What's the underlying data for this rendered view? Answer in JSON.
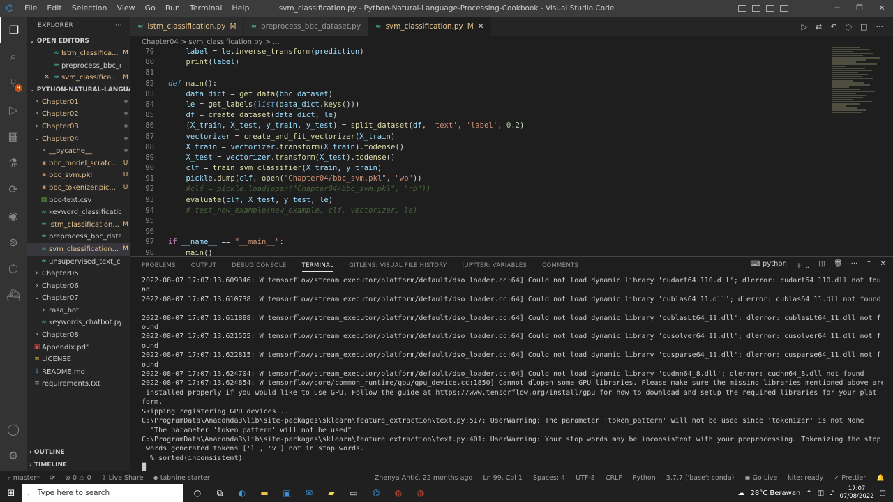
{
  "titlebar": {
    "menu": [
      "File",
      "Edit",
      "Selection",
      "View",
      "Go",
      "Run",
      "Terminal",
      "Help"
    ],
    "window_title": "svm_classification.py - Python-Natural-Language-Processing-Cookbook - Visual Studio Code"
  },
  "explorer": {
    "header": "EXPLORER",
    "open_editors_label": "OPEN EDITORS",
    "open_editors": [
      {
        "name": "lstm_classifica...",
        "status": "M",
        "close": false
      },
      {
        "name": "preprocess_bbc_da...",
        "status": "",
        "close": false
      },
      {
        "name": "svm_classifica...",
        "status": "M",
        "close": true
      }
    ],
    "project_label": "PYTHON-NATURAL-LANGUA...",
    "tree": [
      {
        "name": "Chapter01",
        "type": "folder",
        "indent": 0,
        "status": "dot",
        "color": "#e2c08d"
      },
      {
        "name": "Chapter02",
        "type": "folder",
        "indent": 0,
        "status": "dot",
        "color": "#e2c08d"
      },
      {
        "name": "Chapter03",
        "type": "folder",
        "indent": 0,
        "status": "dot",
        "color": "#e2c08d"
      },
      {
        "name": "Chapter04",
        "type": "folder-open",
        "indent": 0,
        "status": "dot",
        "color": "#e2c08d"
      },
      {
        "name": "__pycache__",
        "type": "folder",
        "indent": 1,
        "status": "dot",
        "color": "#e2c08d"
      },
      {
        "name": "bbc_model_scratc...",
        "type": "file",
        "indent": 1,
        "status": "U",
        "color": "#e2c08d"
      },
      {
        "name": "bbc_svm.pkl",
        "type": "file",
        "indent": 1,
        "status": "U",
        "color": "#e2c08d"
      },
      {
        "name": "bbc_tokenizer.pic...",
        "type": "file",
        "indent": 1,
        "status": "U",
        "color": "#e2c08d"
      },
      {
        "name": "bbc-text.csv",
        "type": "csv",
        "indent": 1,
        "status": "",
        "color": "#cccccc"
      },
      {
        "name": "keyword_classification...",
        "type": "py",
        "indent": 1,
        "status": "",
        "color": "#cccccc"
      },
      {
        "name": "lstm_classification...",
        "type": "py",
        "indent": 1,
        "status": "M",
        "color": "#e2c08d"
      },
      {
        "name": "preprocess_bbc_datase...",
        "type": "py",
        "indent": 1,
        "status": "",
        "color": "#cccccc"
      },
      {
        "name": "svm_classification...",
        "type": "py",
        "indent": 1,
        "status": "M",
        "color": "#e2c08d",
        "selected": true
      },
      {
        "name": "unsupervised_text_clas...",
        "type": "py",
        "indent": 1,
        "status": "",
        "color": "#cccccc"
      },
      {
        "name": "Chapter05",
        "type": "folder",
        "indent": 0,
        "status": "",
        "color": "#cccccc"
      },
      {
        "name": "Chapter06",
        "type": "folder",
        "indent": 0,
        "status": "",
        "color": "#cccccc"
      },
      {
        "name": "Chapter07",
        "type": "folder-open",
        "indent": 0,
        "status": "",
        "color": "#cccccc"
      },
      {
        "name": "rasa_bot",
        "type": "folder",
        "indent": 1,
        "status": "",
        "color": "#cccccc"
      },
      {
        "name": "keywords_chatbot.py",
        "type": "py",
        "indent": 1,
        "status": "",
        "color": "#cccccc"
      },
      {
        "name": "Chapter08",
        "type": "folder",
        "indent": 0,
        "status": "",
        "color": "#cccccc"
      },
      {
        "name": "Appendix.pdf",
        "type": "pdf",
        "indent": 0,
        "status": "",
        "color": "#cccccc"
      },
      {
        "name": "LICENSE",
        "type": "license",
        "indent": 0,
        "status": "",
        "color": "#cccccc"
      },
      {
        "name": "README.md",
        "type": "md",
        "indent": 0,
        "status": "",
        "color": "#cccccc"
      },
      {
        "name": "requirements.txt",
        "type": "txt",
        "indent": 0,
        "status": "",
        "color": "#cccccc"
      }
    ],
    "outline_label": "OUTLINE",
    "timeline_label": "TIMELINE"
  },
  "tabs": [
    {
      "name": "lstm_classification.py",
      "status": "M",
      "active": false
    },
    {
      "name": "preprocess_bbc_dataset.py",
      "status": "",
      "active": false
    },
    {
      "name": "svm_classification.py",
      "status": "M",
      "active": true
    }
  ],
  "breadcrumb": "Chapter04 > svm_classification.py > ...",
  "code_lines": [
    {
      "n": "79",
      "html": "    <span class='v'>label</span> = <span class='v'>le</span>.<span class='f'>inverse_transform</span>(<span class='v'>prediction</span>)"
    },
    {
      "n": "80",
      "html": "    <span class='f'>print</span>(<span class='v'>label</span>)"
    },
    {
      "n": "81",
      "html": ""
    },
    {
      "n": "82",
      "html": "<span class='k'>def</span> <span class='f'>main</span>():"
    },
    {
      "n": "83",
      "html": "    <span class='v'>data_dict</span> = <span class='f'>get_data</span>(<span class='v'>bbc_dataset</span>)"
    },
    {
      "n": "84",
      "html": "    <span class='v'>le</span> = <span class='f'>get_labels</span>(<span class='k'>list</span>(<span class='v'>data_dict</span>.<span class='f'>keys</span>()))"
    },
    {
      "n": "85",
      "html": "    <span class='v'>df</span> = <span class='f'>create_dataset</span>(<span class='v'>data_dict</span>, <span class='v'>le</span>)"
    },
    {
      "n": "86",
      "html": "    (<span class='v'>X_train</span>, <span class='v'>X_test</span>, <span class='v'>y_train</span>, <span class='v'>y_test</span>) = <span class='f'>split_dataset</span>(<span class='v'>df</span>, <span class='s'>'text'</span>, <span class='s'>'label'</span>, <span class='n'>0.2</span>)"
    },
    {
      "n": "87",
      "html": "    <span class='v'>vectorizer</span> = <span class='f'>create_and_fit_vectorizer</span>(<span class='v'>X_train</span>)"
    },
    {
      "n": "88",
      "html": "    <span class='v'>X_train</span> = <span class='v'>vectorizer</span>.<span class='f'>transform</span>(<span class='v'>X_train</span>).<span class='f'>todense</span>()"
    },
    {
      "n": "89",
      "html": "    <span class='v'>X_test</span> = <span class='v'>vectorizer</span>.<span class='f'>transform</span>(<span class='v'>X_test</span>).<span class='f'>todense</span>()"
    },
    {
      "n": "90",
      "html": "    <span class='v'>clf</span> = <span class='f'>train_svm_classifier</span>(<span class='v'>X_train</span>, <span class='v'>y_train</span>)"
    },
    {
      "n": "91",
      "html": "    <span class='v'>pickle</span>.<span class='f'>dump</span>(<span class='v'>clf</span>, <span class='f'>open</span>(<span class='s'>\"Chapter04/bbc_svm.pkl\"</span>, <span class='s'>\"wb\"</span>))"
    },
    {
      "n": "92",
      "html": "    <span class='c'>#clf = pickle.load(open(\"Chapter04/bbc_svm.pkl\", \"rb\"))</span>"
    },
    {
      "n": "93",
      "html": "    <span class='f'>evaluate</span>(<span class='v'>clf</span>, <span class='v'>X_test</span>, <span class='v'>y_test</span>, <span class='v'>le</span>)"
    },
    {
      "n": "94",
      "html": "    <span class='c'># test_new_example(new_example, clf, vectorizer, le)</span>"
    },
    {
      "n": "95",
      "html": ""
    },
    {
      "n": "96",
      "html": ""
    },
    {
      "n": "97",
      "html": "<span class='kk'>if</span> <span class='v'>__name__</span> == <span class='s'>\"__main__\"</span>:"
    },
    {
      "n": "98",
      "html": "    <span class='f'>main</span>()"
    }
  ],
  "panel": {
    "tabs": [
      "PROBLEMS",
      "OUTPUT",
      "DEBUG CONSOLE",
      "TERMINAL",
      "GITLENS: VISUAL FILE HISTORY",
      "JUPYTER: VARIABLES",
      "COMMENTS"
    ],
    "active_tab": "TERMINAL",
    "shell": "python",
    "terminal_lines": [
      "2022-08-07 17:07:13.609346: W tensorflow/stream_executor/platform/default/dso_loader.cc:64] Could not load dynamic library 'cudart64_110.dll'; dlerror: cudart64_110.dll not fou",
      "nd",
      "2022-08-07 17:07:13.610738: W tensorflow/stream_executor/platform/default/dso_loader.cc:64] Could not load dynamic library 'cublas64_11.dll'; dlerror: cublas64_11.dll not found",
      "",
      "2022-08-07 17:07:13.611888: W tensorflow/stream_executor/platform/default/dso_loader.cc:64] Could not load dynamic library 'cublasLt64_11.dll'; dlerror: cublasLt64_11.dll not f",
      "ound",
      "2022-08-07 17:07:13.621555: W tensorflow/stream_executor/platform/default/dso_loader.cc:64] Could not load dynamic library 'cusolver64_11.dll'; dlerror: cusolver64_11.dll not f",
      "ound",
      "2022-08-07 17:07:13.622815: W tensorflow/stream_executor/platform/default/dso_loader.cc:64] Could not load dynamic library 'cusparse64_11.dll'; dlerror: cusparse64_11.dll not f",
      "ound",
      "2022-08-07 17:07:13.624704: W tensorflow/stream_executor/platform/default/dso_loader.cc:64] Could not load dynamic library 'cudnn64_8.dll'; dlerror: cudnn64_8.dll not found",
      "2022-08-07 17:07:13.624854: W tensorflow/core/common_runtime/gpu/gpu_device.cc:1850] Cannot dlopen some GPU libraries. Please make sure the missing libraries mentioned above are",
      " installed properly if you would like to use GPU. Follow the guide at https://www.tensorflow.org/install/gpu for how to download and setup the required libraries for your plat",
      "form.",
      "Skipping registering GPU devices...",
      "C:\\ProgramData\\Anaconda3\\lib\\site-packages\\sklearn\\feature_extraction\\text.py:517: UserWarning: The parameter 'token_pattern' will not be used since 'tokenizer' is not None'",
      "  \"The parameter 'token_pattern' will not be used\"",
      "C:\\ProgramData\\Anaconda3\\lib\\site-packages\\sklearn\\feature_extraction\\text.py:401: UserWarning: Your stop_words may be inconsistent with your preprocessing. Tokenizing the stop",
      " words generated tokens ['l', 'v'] not in stop_words.",
      "  % sorted(inconsistent)"
    ]
  },
  "statusbar": {
    "branch": "master*",
    "errors": "0",
    "warnings": "0",
    "live_share": "Live Share",
    "tabnine": "tabnine starter",
    "blame": "Zhenya Antić, 22 months ago",
    "position": "Ln 99, Col 1",
    "spaces": "Spaces: 4",
    "encoding": "UTF-8",
    "eol": "CRLF",
    "language": "Python",
    "interpreter": "3.7.7 ('base': conda)",
    "golive": "Go Live",
    "kite": "kite: ready",
    "prettier": "Prettier"
  },
  "taskbar": {
    "search_placeholder": "Type here to search",
    "weather": "28°C Berawan",
    "time": "17:07",
    "date": "07/08/2022"
  }
}
